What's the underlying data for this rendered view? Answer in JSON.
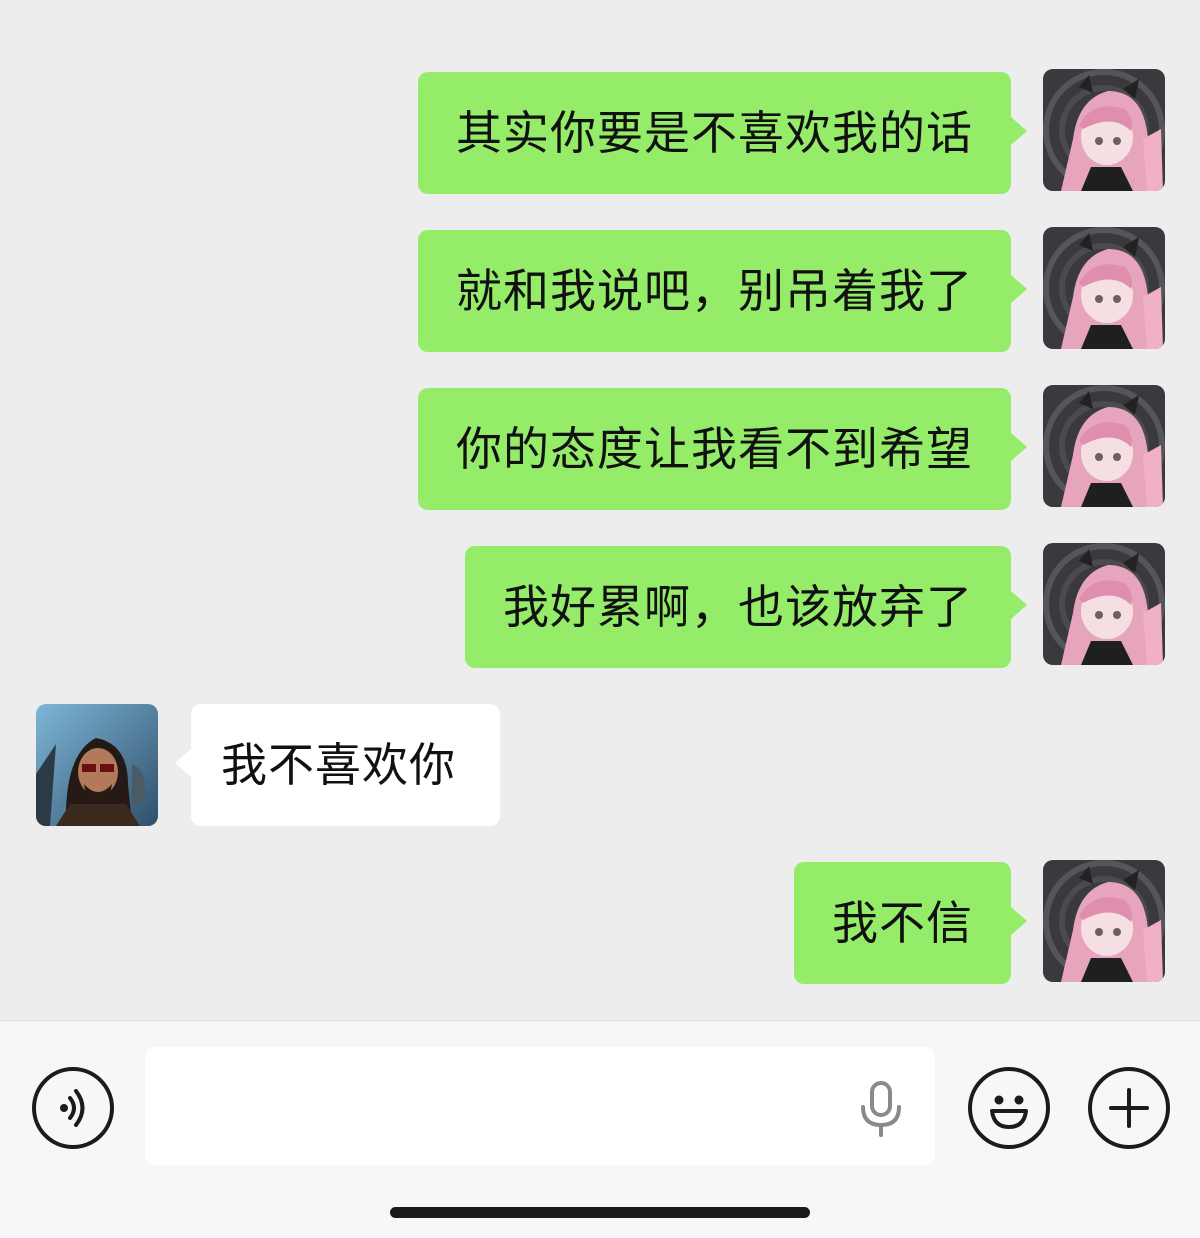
{
  "messages": [
    {
      "sender": "me",
      "text": "其实你要是不喜欢我的话"
    },
    {
      "sender": "me",
      "text": "就和我说吧，别吊着我了"
    },
    {
      "sender": "me",
      "text": "你的态度让我看不到希望"
    },
    {
      "sender": "me",
      "text": "我好累啊，也该放弃了"
    },
    {
      "sender": "them",
      "text": "我不喜欢你"
    },
    {
      "sender": "me",
      "text": "我不信"
    }
  ],
  "input": {
    "value": "",
    "voice_icon": "voice-mode-icon",
    "mic_icon": "microphone-icon",
    "emoji_icon": "emoji-icon",
    "plus_icon": "plus-icon"
  },
  "colors": {
    "background": "#ededed",
    "my_bubble": "#95ec69",
    "their_bubble": "#ffffff",
    "bottom_bar": "#f7f7f7"
  }
}
